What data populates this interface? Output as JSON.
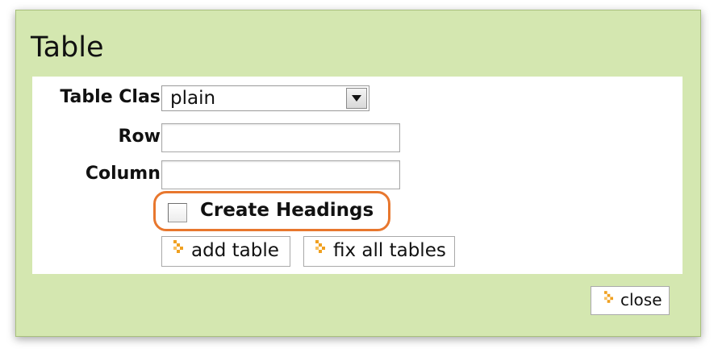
{
  "dialog": {
    "title": "Table"
  },
  "form": {
    "table_class_label": "Table Class",
    "table_class_value": "plain",
    "rows_label": "Rows",
    "rows_value": "",
    "columns_label": "Columns",
    "columns_value": "",
    "create_headings_label": "Create Headings",
    "create_headings_checked": false
  },
  "buttons": {
    "add_table": "add table",
    "fix_all_tables": "fix all tables",
    "close": "close"
  },
  "colors": {
    "dialog_background": "#d4e7b0",
    "highlight_outline": "#e8772e",
    "button_icon": "#f0a020"
  },
  "icons": {
    "button_icon": "orange-arrow-icon"
  }
}
